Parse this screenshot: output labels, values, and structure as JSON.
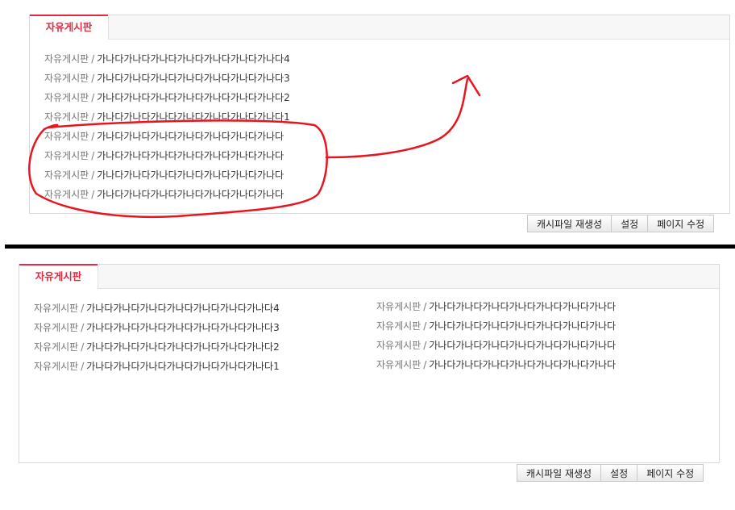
{
  "board_tab": "자유게시판",
  "top_panel": {
    "posts": [
      {
        "category": "자유게시판",
        "title": "가나다가나다가나다가나다가나다가나다가나다4"
      },
      {
        "category": "자유게시판",
        "title": "가나다가나다가나다가나다가나다가나다가나다3"
      },
      {
        "category": "자유게시판",
        "title": "가나다가나다가나다가나다가나다가나다가나다2"
      },
      {
        "category": "자유게시판",
        "title": "가나다가나다가나다가나다가나다가나다가나다1"
      },
      {
        "category": "자유게시판",
        "title": "가나다가나다가나다가나다가나다가나다가나다"
      },
      {
        "category": "자유게시판",
        "title": "가나다가나다가나다가나다가나다가나다가나다"
      },
      {
        "category": "자유게시판",
        "title": "가나다가나다가나다가나다가나다가나다가나다"
      },
      {
        "category": "자유게시판",
        "title": "가나다가나다가나다가나다가나다가나다가나다"
      }
    ]
  },
  "bottom_panel": {
    "left_posts": [
      {
        "category": "자유게시판",
        "title": "가나다가나다가나다가나다가나다가나다가나다4"
      },
      {
        "category": "자유게시판",
        "title": "가나다가나다가나다가나다가나다가나다가나다3"
      },
      {
        "category": "자유게시판",
        "title": "가나다가나다가나다가나다가나다가나다가나다2"
      },
      {
        "category": "자유게시판",
        "title": "가나다가나다가나다가나다가나다가나다가나다1"
      }
    ],
    "right_posts": [
      {
        "category": "자유게시판",
        "title": "가나다가나다가나다가나다가나다가나다가나다"
      },
      {
        "category": "자유게시판",
        "title": "가나다가나다가나다가나다가나다가나다가나다"
      },
      {
        "category": "자유게시판",
        "title": "가나다가나다가나다가나다가나다가나다가나다"
      },
      {
        "category": "자유게시판",
        "title": "가나다가나다가나다가나다가나다가나다가나다"
      }
    ]
  },
  "buttons": {
    "regen_cache": "캐시파일 재생성",
    "settings": "설정",
    "edit_page": "페이지 수정"
  },
  "separator": "/",
  "colors": {
    "accent": "#e02a3e",
    "annotation": "#e8141e",
    "divider": "#000000"
  }
}
